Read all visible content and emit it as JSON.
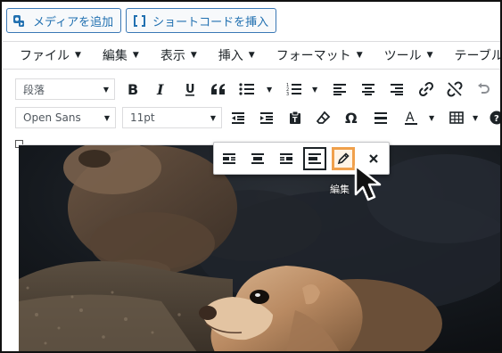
{
  "top_buttons": {
    "media": "メディアを追加",
    "shortcode": "ショートコードを挿入"
  },
  "menubar": [
    {
      "label": "ファイル"
    },
    {
      "label": "編集"
    },
    {
      "label": "表示"
    },
    {
      "label": "挿入"
    },
    {
      "label": "フォーマット"
    },
    {
      "label": "ツール"
    },
    {
      "label": "テーブル"
    }
  ],
  "toolbar1": {
    "format_select": "段落",
    "icons": [
      "bold-icon",
      "italic-icon",
      "underline-icon",
      "blockquote-icon",
      "bullet-list-icon",
      "numbered-list-icon",
      "align-left-icon",
      "align-center-icon",
      "align-right-icon",
      "link-icon",
      "unlink-icon",
      "undo-icon"
    ]
  },
  "toolbar2": {
    "font_family": "Open Sans",
    "font_size": "11pt",
    "icons": [
      "outdent-icon",
      "indent-icon",
      "paste-text-icon",
      "clear-formatting-icon",
      "special-character-icon",
      "horizontal-line-icon",
      "text-color-icon",
      "table-icon",
      "help-icon"
    ]
  },
  "image_toolbar": {
    "buttons": [
      "align-left-icon",
      "align-center-icon",
      "align-right-icon",
      "align-none-icon",
      "edit-pencil-icon",
      "remove-icon"
    ],
    "active": "align-none-icon",
    "highlighted": "edit-pencil-icon",
    "tooltip": "編集"
  },
  "colors": {
    "accent": "#2271b1",
    "highlight": "#f0a04b",
    "text": "#1d2327"
  }
}
